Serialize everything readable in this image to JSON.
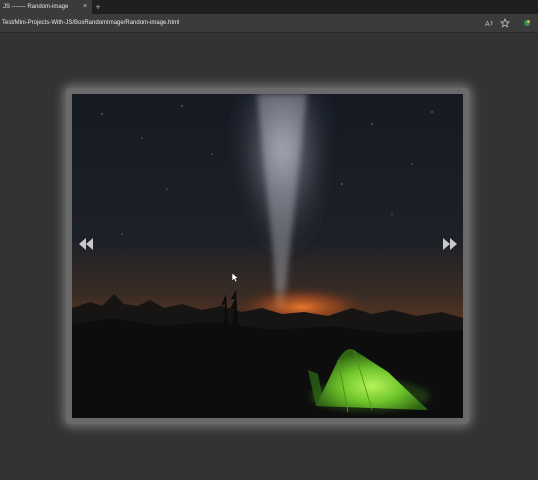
{
  "browser": {
    "tab_title": "JS ------- Random-image",
    "tab_close": "×",
    "new_tab": "+",
    "url": "Test/Mini-Projects-With-JS/BoxRandomImage/Random-image.html",
    "read_aloud_icon": "read-aloud-icon",
    "favorite_icon": "star-icon",
    "extension_icon": "extension-icon"
  },
  "slider": {
    "prev_icon": "double-chevron-left-icon",
    "next_icon": "double-chevron-right-icon",
    "image": "night sky with milky way and green tent"
  }
}
